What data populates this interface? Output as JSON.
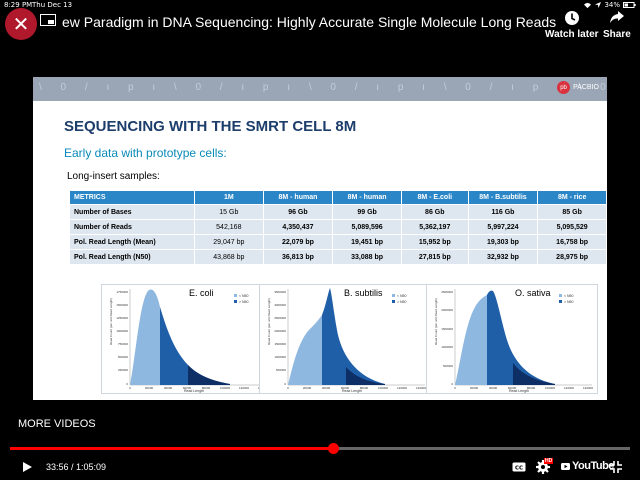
{
  "status_bar": {
    "time": "8:29 PM",
    "date": "Thu Dec 13",
    "battery": "34%"
  },
  "video": {
    "title": "ew Paradigm in DNA Sequencing: Highly Accurate Single Molecule Long Reads"
  },
  "top_actions": [
    {
      "label": "Watch later",
      "icon": "clock-icon"
    },
    {
      "label": "Share",
      "icon": "share-icon"
    }
  ],
  "slide": {
    "logo_text": "PACBIO",
    "logo_mark": "pb",
    "band_text": "\\ 0 / ı p ı \\ 0 / ı p ı \\ 0 / ı p ı \\ 0 / ı p ı \\ 0 / ı p ı \\ 0 / ı p b",
    "title": "SEQUENCING WITH THE SMRT CELL 8M",
    "subtitle": "Early data with prototype cells:",
    "subtitle2": "Long-insert samples:",
    "table": {
      "headers": [
        "METRICS",
        "1M",
        "8M - human",
        "8M - human",
        "8M - E.coli",
        "8M - B.subtilis",
        "8M - rice"
      ],
      "rows": [
        [
          "Number of Bases",
          "15 Gb",
          "96 Gb",
          "99 Gb",
          "86 Gb",
          "116 Gb",
          "85 Gb"
        ],
        [
          "Number of Reads",
          "542,168",
          "4,350,437",
          "5,089,596",
          "5,362,197",
          "5,997,224",
          "5,095,529"
        ],
        [
          "Pol. Read Length (Mean)",
          "29,047 bp",
          "22,079 bp",
          "19,451 bp",
          "15,952 bp",
          "19,303 bp",
          "16,758 bp"
        ],
        [
          "Pol. Read Length (N50)",
          "43,868 bp",
          "36,813 bp",
          "33,088 bp",
          "27,815 bp",
          "32,932 bp",
          "28,975 bp"
        ]
      ]
    },
    "charts": [
      {
        "name": "E. coli",
        "yticks": [
          "1750000",
          "1500000",
          "1250000",
          "1000000",
          "750000",
          "500000",
          "250000",
          "0"
        ],
        "xticks": [
          "0",
          "20000",
          "40000",
          "60000",
          "80000",
          "100000",
          "120000",
          "140000"
        ],
        "legend": [
          "< N50",
          "> N50"
        ],
        "xlabel": "Read Length",
        "ylabel": "Read Count (per unit Read Length)"
      },
      {
        "name": "B. subtilis",
        "yticks": [
          "3500000",
          "3000000",
          "2500000",
          "2000000",
          "1500000",
          "1000000",
          "500000",
          "0"
        ],
        "xticks": [
          "0",
          "20000",
          "40000",
          "60000",
          "80000",
          "100000",
          "120000",
          "140000"
        ],
        "legend": [
          "< N50",
          "> N50"
        ],
        "xlabel": "Read Length",
        "ylabel": "Read Count (per unit Read Length)"
      },
      {
        "name": "O. sativa",
        "yticks": [
          "2500000",
          "2000000",
          "1500000",
          "1000000",
          "500000",
          "0"
        ],
        "xticks": [
          "0",
          "20000",
          "40000",
          "60000",
          "80000",
          "100000",
          "120000",
          "140000"
        ],
        "legend": [
          "< N50",
          "> N50"
        ],
        "xlabel": "Read Length",
        "ylabel": "Read Count (per unit Read Length)"
      }
    ]
  },
  "more_videos": "MORE VIDEOS",
  "player": {
    "current_time": "33:56",
    "duration": "1:05:09",
    "time_display": "33:56 / 1:05:09",
    "progress": 0.521,
    "youtube_label": "YouTube",
    "hd_badge": "HD"
  },
  "colors": {
    "accent": "#ff0000",
    "close": "#b0182b",
    "header_blue": "#2a86c6",
    "title_blue": "#1d3d6b",
    "sub_blue": "#0b8ab9"
  }
}
